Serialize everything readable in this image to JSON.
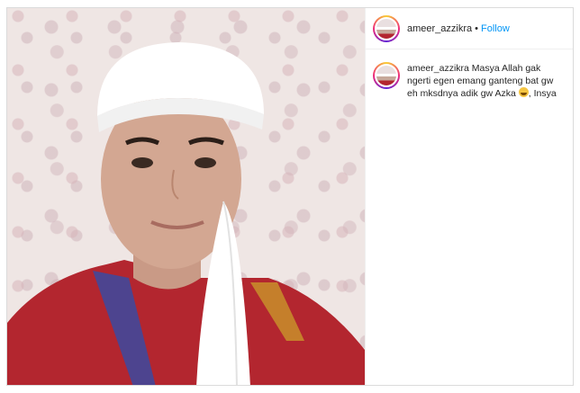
{
  "post": {
    "image_alt": "photo of a young man wearing a white cap and red embroidered shirt"
  },
  "header": {
    "username": "ameer_azzikra",
    "separator": "•",
    "follow_label": "Follow"
  },
  "caption": {
    "username": "ameer_azzikra",
    "text_before_emoji": "Masya Allah gak ngerti egen emang ganteng bat gw eh mksdnya adik gw Azka",
    "emoji": "grinning-face-icon",
    "text_after_emoji": ", Insya"
  },
  "colors": {
    "link": "#0095f6",
    "border": "#dbdbdb",
    "shirt": "#b3262f",
    "cap": "#ffffff"
  }
}
